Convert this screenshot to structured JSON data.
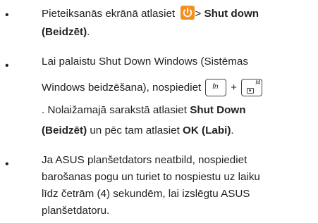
{
  "bullets": [
    {
      "lines": [
        {
          "text_before": "Pieteiksanās ekrānā atlasiet ",
          "icon": "power-icon",
          "text_after_icon": "> ",
          "bold": "Shut down"
        },
        {
          "bold": "(Beidzēt)",
          "text": "."
        }
      ]
    },
    {
      "lines": [
        {
          "text": "Lai palaistu Shut Down Windows (Sistēmas"
        },
        {
          "text": "Windows beidzēšana), nospiediet",
          "key1": "fn",
          "plus": "+",
          "key2_label": "f4",
          "key2_icon": "camera-icon"
        },
        {
          "text": ". Nolaižamajā sarakstā atlasiet ",
          "bold": "Shut Down"
        },
        {
          "bold": "(Beidzēt)",
          "text": " un pēc tam atlasiet ",
          "bold2": "OK (Labi)",
          "text2": "."
        }
      ]
    },
    {
      "lines": [
        {
          "text": "Ja ASUS planšetdators neatbild, nospiediet"
        },
        {
          "text": "barošanas pogu un turiet to nospiestu uz laiku"
        },
        {
          "text": "līdz četrām (4) sekundēm, lai izslēgtu ASUS"
        },
        {
          "text": "planšetdatoru."
        }
      ]
    }
  ],
  "bullet_char": "•",
  "colors": {
    "power_icon": "#f39021"
  }
}
